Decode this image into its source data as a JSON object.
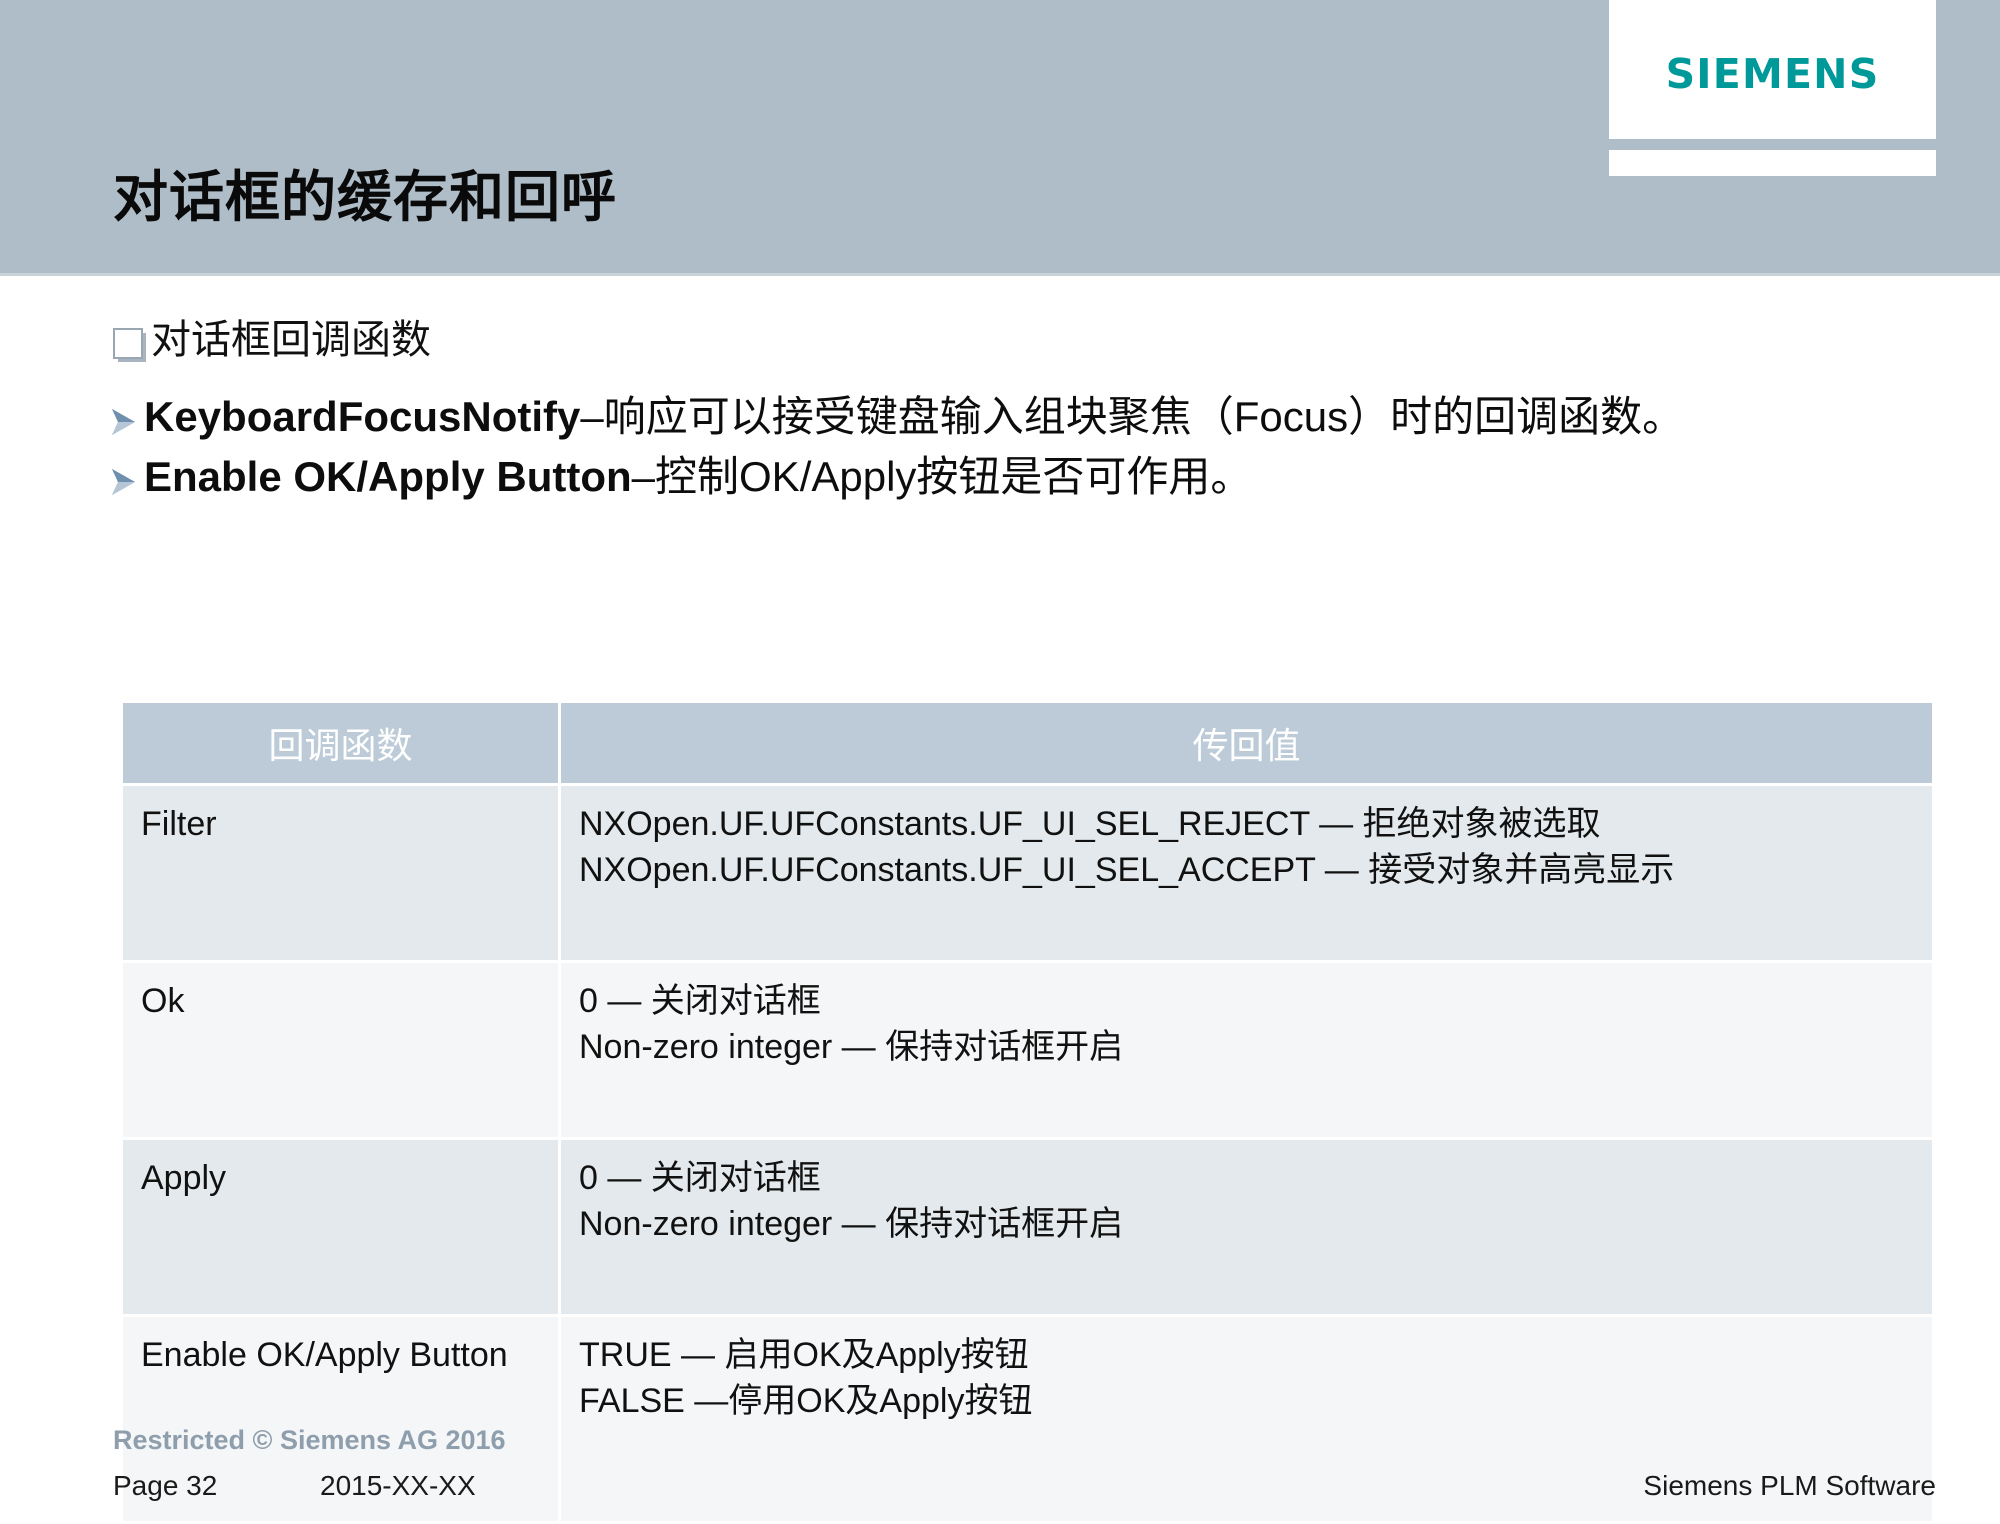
{
  "header": {
    "title": "对话框的缓存和回呼",
    "logo_text": "SIEMENS",
    "band_color": "#aebdc7",
    "logo_color": "#009999"
  },
  "body": {
    "bullet_level1": "对话框回调函数",
    "bullets_level2": [
      {
        "english": "KeyboardFocusNotify",
        "chinese": "–响应可以接受键盘输入组块聚焦（Focus）时的回调函数。"
      },
      {
        "english": "Enable OK/Apply Button",
        "chinese": "–控制OK/Apply按钮是否可作用。"
      }
    ]
  },
  "table": {
    "headers": [
      "回调函数",
      "传回值"
    ],
    "header_bg": "#bccbd7",
    "rows": [
      {
        "callback": "Filter",
        "values": [
          "NXOpen.UF.UFConstants.UF_UI_SEL_REJECT — 拒绝对象被选取",
          "NXOpen.UF.UFConstants.UF_UI_SEL_ACCEPT — 接受对象并高亮显示"
        ]
      },
      {
        "callback": "Ok",
        "values": [
          "0 — 关闭对话框",
          "Non-zero integer — 保持对话框开启"
        ]
      },
      {
        "callback": "Apply",
        "values": [
          "0 — 关闭对话框",
          "Non-zero integer — 保持对话框开启"
        ]
      },
      {
        "callback": "Enable OK/Apply Button",
        "values": [
          "TRUE — 启用OK及Apply按钮",
          "FALSE —停用OK及Apply按钮"
        ]
      }
    ]
  },
  "footer": {
    "restricted": "Restricted © Siemens AG 2016",
    "page": "Page 32",
    "date": "2015-XX-XX",
    "brand": "Siemens PLM Software"
  }
}
